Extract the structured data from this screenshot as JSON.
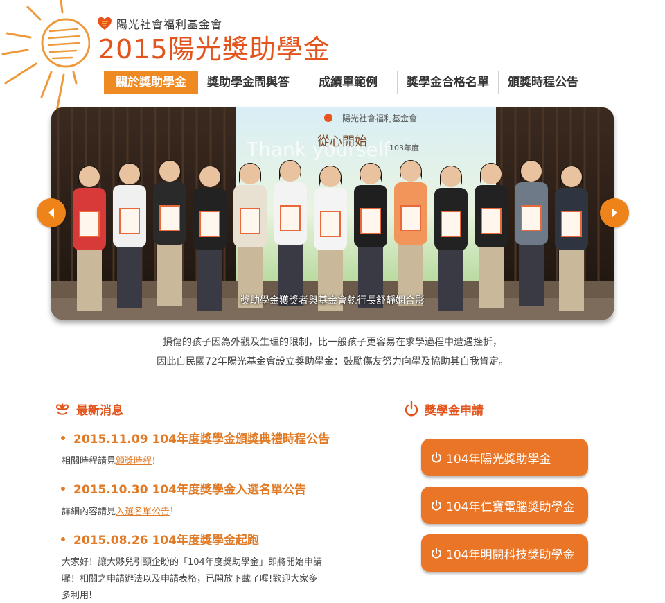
{
  "org": {
    "name": "陽光社會福利基金會",
    "logo_icon": "sunshine-heart-logo"
  },
  "site_title": "2015陽光獎助學金",
  "nav": [
    {
      "label": "關於獎助學金",
      "active": true
    },
    {
      "label": "獎助學金問與答",
      "active": false
    },
    {
      "label": "成績單範例",
      "active": false
    },
    {
      "label": "獎學金合格名單",
      "active": false
    },
    {
      "label": "頒獎時程公告",
      "active": false
    }
  ],
  "slider": {
    "caption": "獎助學金獲獎者與基金會執行長舒靜嫻合影",
    "banner_org": "陽光社會福利基金會",
    "banner_text": "Thank yourself",
    "banner_slogan": "從心開始",
    "banner_year": "103年度",
    "prev_icon": "chevron-left-icon",
    "next_icon": "chevron-right-icon"
  },
  "intro": {
    "line1": "損傷的孩子因為外觀及生理的限制，比一般孩子更容易在求學過程中遭遇挫折，",
    "line2": "因此自民國72年陽光基金會設立獎助學金：鼓勵傷友努力向學及協助其自我肯定。"
  },
  "news": {
    "title": "最新消息",
    "icon": "flower-icon",
    "items": [
      {
        "title": "2015.11.09 104年度獎學金頒獎典禮時程公告",
        "pre": "相關時程請見",
        "link": "頒獎時程",
        "post": "！"
      },
      {
        "title": "2015.10.30 104年度獎學金入選名單公告",
        "pre": "詳細內容請見",
        "link": "入選名單公告",
        "post": "！"
      },
      {
        "title": "2015.08.26 104年度獎學金起跑",
        "line1": "大家好！讓大夥兒引頸企盼的「104年度獎助學金」即將開始申請",
        "line2": "囉！相關之申請辦法以及申請表格，已開放下載了喔!歡迎大家多",
        "line3": "多利用!"
      }
    ]
  },
  "apply": {
    "title": "獎學金申請",
    "icon": "power-icon",
    "buttons": [
      {
        "label": "104年陽光獎助學金"
      },
      {
        "label": "104年仁寶電腦獎助學金"
      },
      {
        "label": "104年明閱科技獎助學金"
      }
    ]
  },
  "colors": {
    "accent": "#ef8a22",
    "title": "#e3541d",
    "button": "#ea7526"
  }
}
